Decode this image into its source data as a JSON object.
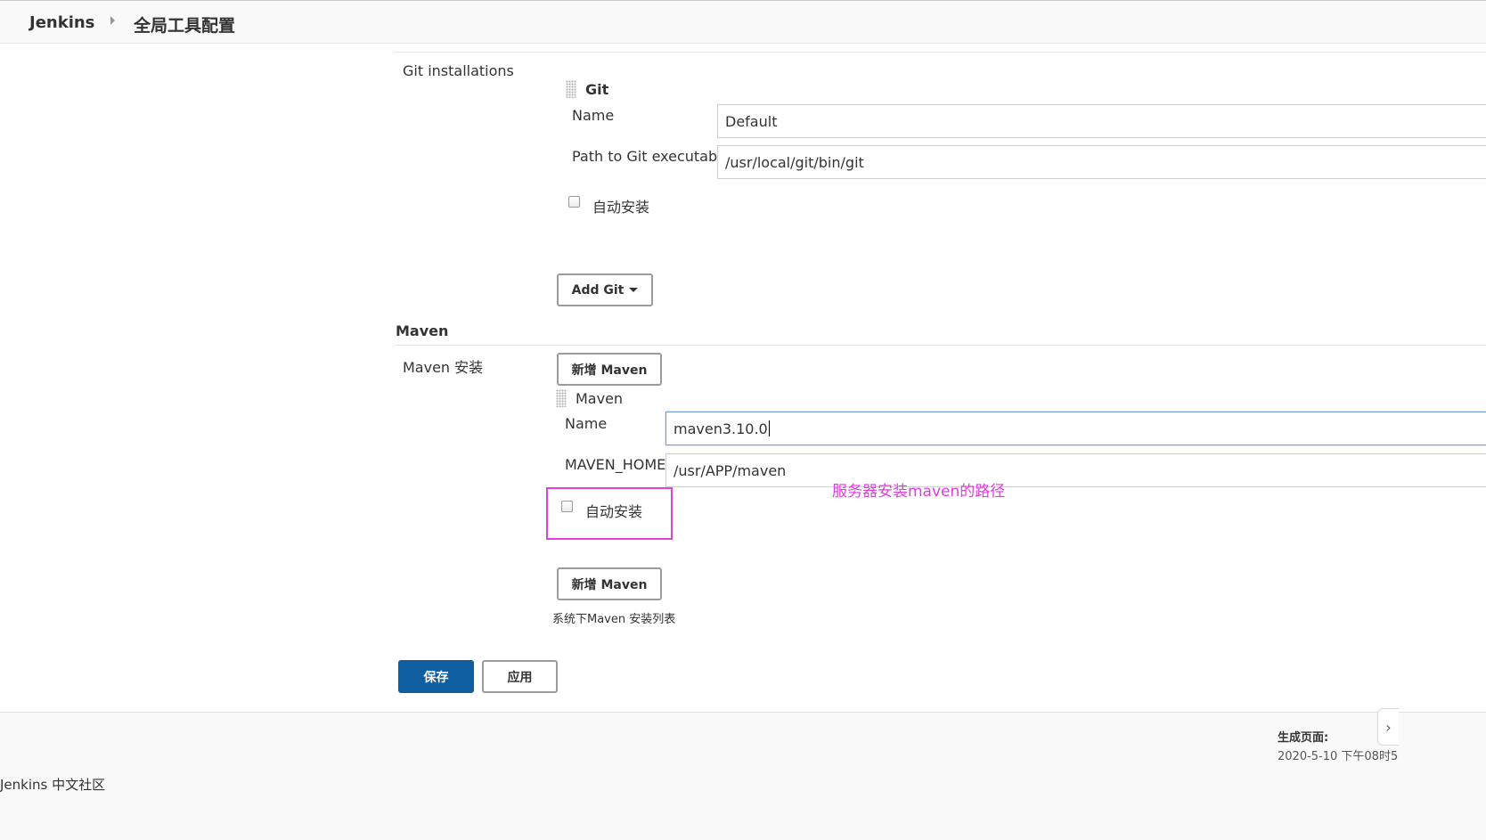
{
  "breadcrumb": {
    "root": "Jenkins",
    "page": "全局工具配置"
  },
  "git": {
    "section_label": "Git installations",
    "installation_title": "Git",
    "name_label": "Name",
    "name_value": "Default",
    "path_label": "Path to Git executable",
    "path_value": "/usr/local/git/bin/git",
    "auto_install_label": "自动安装",
    "auto_install_checked": false,
    "add_button": "Add Git"
  },
  "maven": {
    "section_title": "Maven",
    "install_label": "Maven 安装",
    "add_button_top": "新增 Maven",
    "installation_title": "Maven",
    "name_label": "Name",
    "name_value": "maven3.10.0",
    "home_label": "MAVEN_HOME",
    "home_value": "/usr/APP/maven",
    "auto_install_label": "自动安装",
    "auto_install_checked": false,
    "add_button_bottom": "新增 Maven",
    "list_description": "系统下Maven 安装列表"
  },
  "annotation": {
    "text": "服务器安装maven的路径",
    "color": "#e03be0"
  },
  "actions": {
    "save": "保存",
    "apply": "应用"
  },
  "footer": {
    "generated_label": "生成页面:",
    "generated_value": "2020-5-10 下午08时5",
    "community": "Jenkins 中文社区"
  },
  "colors": {
    "primary_button": "#0f5fa0",
    "annotation_box": "#e040e0"
  }
}
